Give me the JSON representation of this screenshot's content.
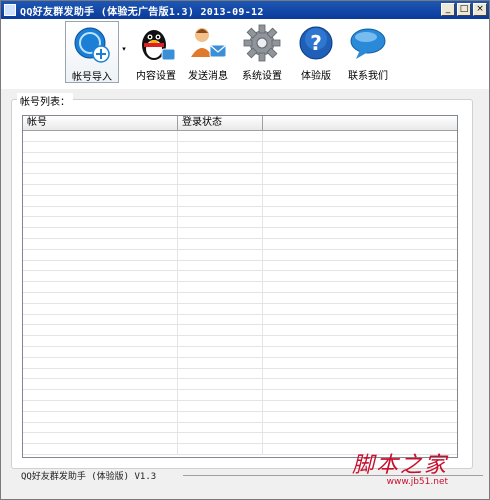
{
  "window": {
    "title": "QQ好友群发助手  (体验无广告版1.3)  2013-09-12",
    "controls": {
      "minimize": "_",
      "maximize": "□",
      "close": "×"
    }
  },
  "toolbar": {
    "items": [
      {
        "label": "帐号导入",
        "icon": "account-import-icon"
      },
      {
        "label": "内容设置",
        "icon": "qq-penguin-icon"
      },
      {
        "label": "发送消息",
        "icon": "send-message-icon"
      },
      {
        "label": "系统设置",
        "icon": "gear-icon"
      },
      {
        "label": "体验版",
        "icon": "help-icon"
      },
      {
        "label": "联系我们",
        "icon": "chat-bubble-icon"
      }
    ],
    "dropdown_glyph": "▾"
  },
  "account_list": {
    "group_label": "帐号列表：",
    "columns": [
      "帐号",
      "登录状态",
      ""
    ]
  },
  "status": {
    "text": "QQ好友群发助手  (体验版)  V1.3"
  },
  "watermark": {
    "main": "脚本之家",
    "sub": "www.jb51.net"
  },
  "colors": {
    "title_bar": "#0a3a9a",
    "watermark": "#c8102e",
    "accent_blue": "#1b7fd6"
  }
}
